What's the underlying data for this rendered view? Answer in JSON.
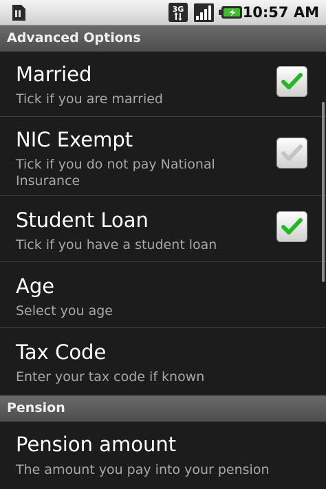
{
  "status_bar": {
    "time": "10:57 AM",
    "network_label": "3G",
    "icons": [
      "sim-card-icon",
      "3g-data-icon",
      "signal-strength-icon",
      "battery-charging-icon"
    ]
  },
  "sections": [
    {
      "header": "Advanced Options",
      "items": [
        {
          "title": "Married",
          "summary": "Tick if you are married",
          "checkbox": true,
          "checked": true,
          "enabled": true
        },
        {
          "title": "NIC Exempt",
          "summary": "Tick if you do not pay National Insurance",
          "checkbox": true,
          "checked": false,
          "enabled": true
        },
        {
          "title": "Student Loan",
          "summary": "Tick if you have a student loan",
          "checkbox": true,
          "checked": true,
          "enabled": true
        },
        {
          "title": "Age",
          "summary": "Select you age"
        },
        {
          "title": "Tax Code",
          "summary": "Enter your tax code if known"
        }
      ]
    },
    {
      "header": "Pension",
      "items": [
        {
          "title": "Pension amount",
          "summary": "The amount you pay into your pension"
        }
      ]
    }
  ],
  "colors": {
    "background": "#1c1c1c",
    "header_bg": "#5c5c5c",
    "title_text": "#ffffff",
    "summary_text": "#a8a8a8",
    "check_green": "#22b822",
    "check_grey": "#c4c4c4"
  }
}
